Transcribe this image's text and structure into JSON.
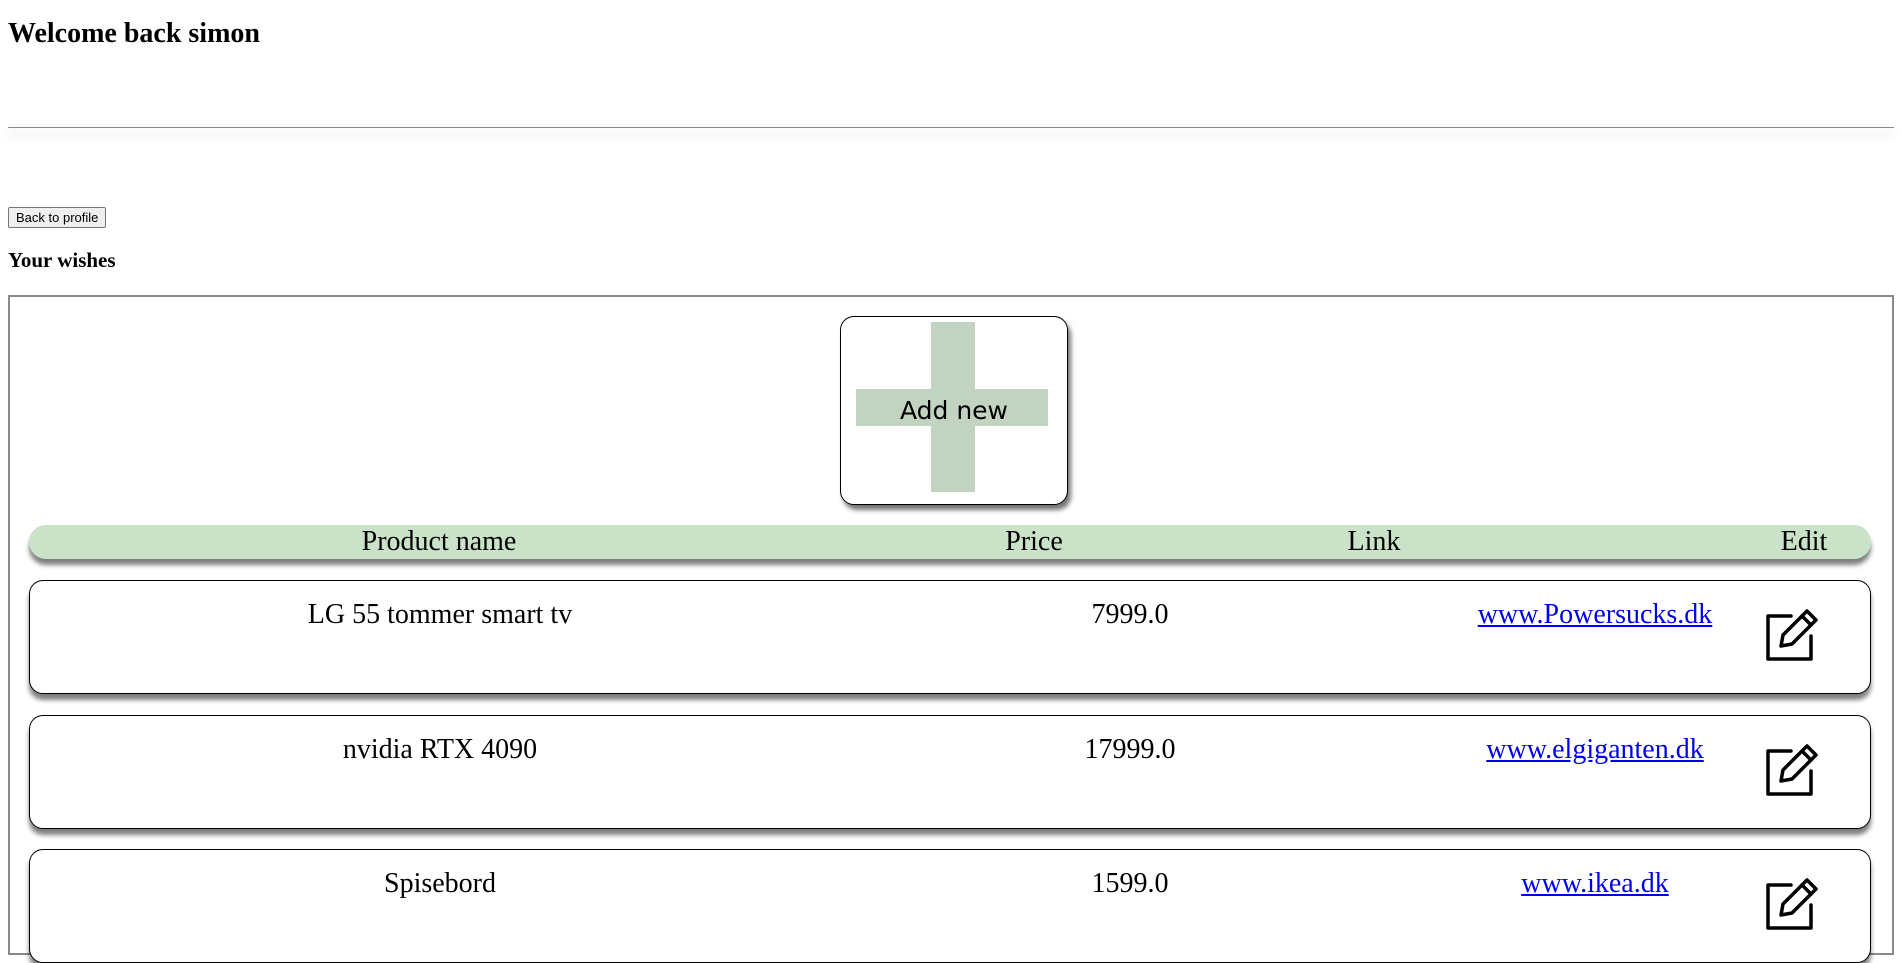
{
  "header": {
    "welcome": "Welcome back simon"
  },
  "nav": {
    "back_label": "Back to profile"
  },
  "wishes": {
    "title": "Your wishes",
    "add_new_label": "Add new",
    "columns": {
      "name": "Product name",
      "price": "Price",
      "link": "Link",
      "edit": "Edit"
    },
    "rows": [
      {
        "name": "LG 55 tommer smart tv",
        "price": "7999.0",
        "link": "www.Powersucks.dk"
      },
      {
        "name": "nvidia RTX 4090",
        "price": "17999.0",
        "link": "www.elgiganten.dk"
      },
      {
        "name": "Spisebord",
        "price": "1599.0",
        "link": "www.ikea.dk"
      }
    ]
  },
  "icons": {
    "edit": "edit-pencil-square-icon",
    "add": "plus-icon"
  },
  "colors": {
    "accent_green": "#c9e2c8",
    "plus_green": "#c3d3c2",
    "link_blue": "#0000ee"
  }
}
